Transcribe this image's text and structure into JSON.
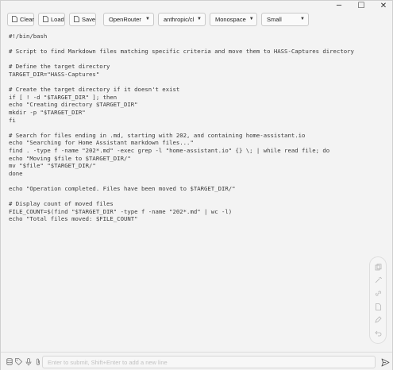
{
  "window": {
    "controls": {
      "minimize": "─",
      "maximize": "☐",
      "close": "✕"
    }
  },
  "toolbar": {
    "clear_label": "Clear",
    "load_label": "Load",
    "save_label": "Save",
    "provider_value": "OpenRouter",
    "model_value": "anthropic/claude",
    "font_value": "Monospace",
    "size_value": "Small"
  },
  "editor": {
    "lines": [
      "#!/bin/bash",
      "",
      "# Script to find Markdown files matching specific criteria and move them to HASS-Captures directory",
      "",
      "# Define the target directory",
      "TARGET_DIR=\"HASS-Captures\"",
      "",
      "# Create the target directory if it doesn't exist",
      "if [ ! -d \"$TARGET_DIR\" ]; then",
      "echo \"Creating directory $TARGET_DIR\"",
      "mkdir -p \"$TARGET_DIR\"",
      "fi",
      "",
      "# Search for files ending in .md, starting with 202, and containing home-assistant.io",
      "echo \"Searching for Home Assistant markdown files...\"",
      "find . -type f -name \"202*.md\" -exec grep -l \"home-assistant.io\" {} \\; | while read file; do",
      "echo \"Moving $file to $TARGET_DIR/\"",
      "mv \"$file\" \"$TARGET_DIR/\"",
      "done",
      "",
      "echo \"Operation completed. Files have been moved to $TARGET_DIR/\"",
      "",
      "# Display count of moved files",
      "FILE_COUNT=$(find \"$TARGET_DIR\" -type f -name \"202*.md\" | wc -l)",
      "echo \"Total files moved: $FILE_COUNT\""
    ]
  },
  "sidepanel": {
    "icons": [
      "copy-icon",
      "magic-icon",
      "link-icon",
      "document-icon",
      "edit-icon",
      "undo-icon"
    ]
  },
  "bottombar": {
    "input_placeholder": "Enter to submit, Shift+Enter to add a new line",
    "left_icons": [
      "database-icon",
      "tag-icon",
      "microphone-icon",
      "attachment-icon"
    ]
  }
}
